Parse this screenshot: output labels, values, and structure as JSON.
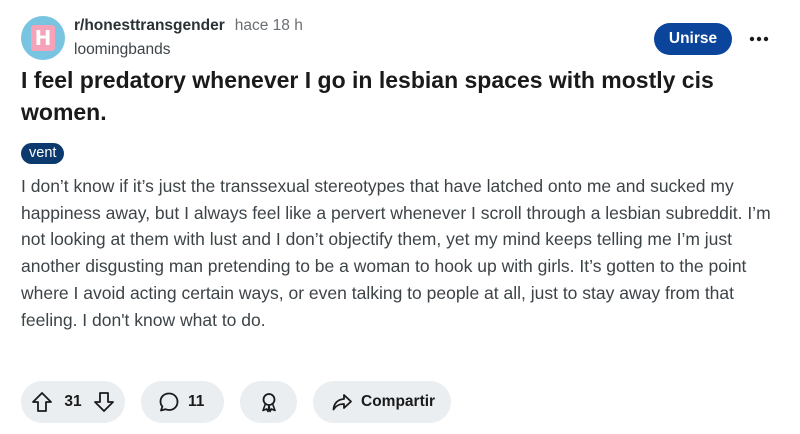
{
  "header": {
    "subreddit": "r/honesttransgender",
    "time_ago": "hace 18 h",
    "username": "loomingbands",
    "join_label": "Unirse",
    "avatar_letter": "H"
  },
  "post": {
    "title": "I feel predatory whenever I go in lesbian spaces with mostly cis women.",
    "flair": "vent",
    "body": "I don’t know if it’s just the transsexual stereotypes that have latched onto me and sucked my happiness away, but I always feel like a pervert whenever I scroll through a lesbian subreddit. I’m not looking at them with lust and I don’t objectify them, yet my mind keeps telling me I’m just another disgusting man pretending to be a woman to hook up with girls. It’s gotten to the point where I avoid acting certain ways, or even talking to people at all, just to stay away from that feeling. I don't know what to do."
  },
  "actions": {
    "vote_count": "31",
    "comment_count": "11",
    "share_label": "Compartir"
  },
  "colors": {
    "join_button": "#0a449b",
    "flair": "#0c3a6e",
    "action_pill": "#eaeef0",
    "avatar_bg": "#79c4e0",
    "avatar_tile": "#f6a2b8"
  },
  "icons": [
    "upvote-icon",
    "downvote-icon",
    "comment-icon",
    "award-icon",
    "share-icon",
    "more-options-icon"
  ]
}
